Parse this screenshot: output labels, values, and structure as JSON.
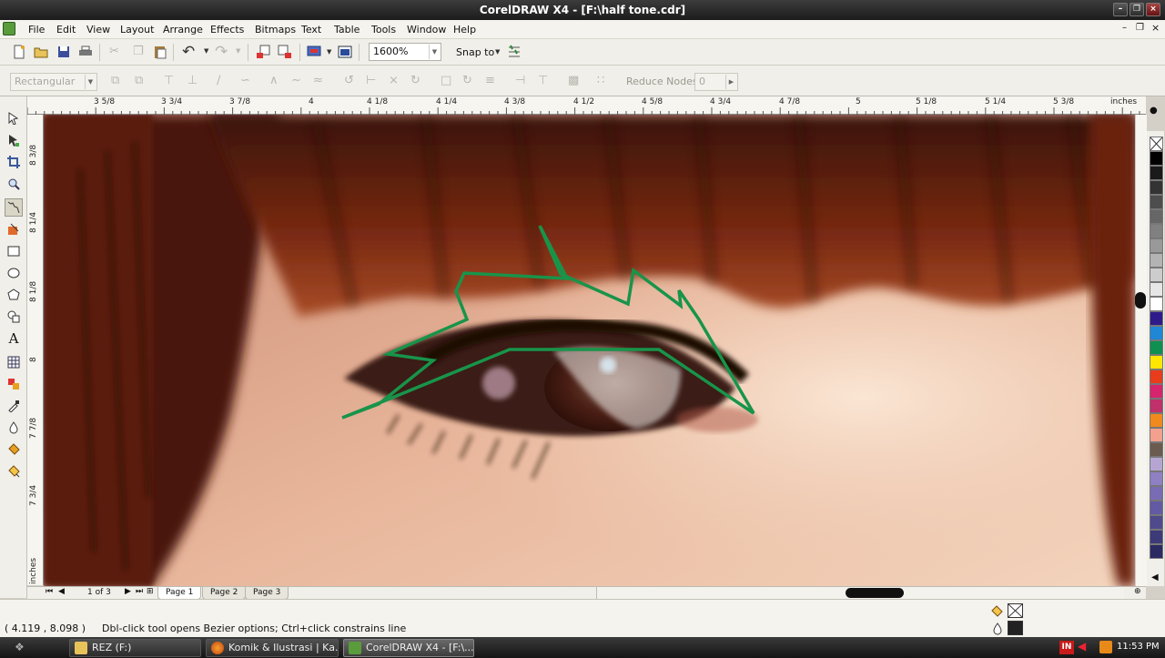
{
  "window": {
    "title": "CorelDRAW X4 - [F:\\half tone.cdr]"
  },
  "menu": [
    "File",
    "Edit",
    "View",
    "Layout",
    "Arrange",
    "Effects",
    "Bitmaps",
    "Text",
    "Table",
    "Tools",
    "Window",
    "Help"
  ],
  "toolbar": {
    "zoom": "1600%",
    "snap_label": "Snap to"
  },
  "property_bar": {
    "mode": "Rectangular",
    "reduce_nodes_label": "Reduce Nodes",
    "reduce_nodes_value": "0"
  },
  "ruler": {
    "unit": "inches",
    "h_labels": [
      "3 5/8",
      "3 3/4",
      "3 7/8",
      "4",
      "4 1/8",
      "4 1/4",
      "4 3/8",
      "4 1/2",
      "4 5/8",
      "4 3/4",
      "4 7/8",
      "5",
      "5 1/8",
      "5 1/4",
      "5 3/8"
    ],
    "v_labels": [
      "8 3/8",
      "8 1/4",
      "8 1/8",
      "8",
      "7 7/8",
      "7 3/4"
    ]
  },
  "pages": {
    "count_label": "1 of 3",
    "tabs": [
      "Page 1",
      "Page 2",
      "Page 3"
    ]
  },
  "status": {
    "coords": "( 4.119 , 8.098 )",
    "hint": "Dbl-click tool opens Bezier options; Ctrl+click constrains line"
  },
  "palette": [
    "#ffffff",
    "#000000",
    "#1a1a1a",
    "#333333",
    "#4d4d4d",
    "#666666",
    "#808080",
    "#999999",
    "#b3b3b3",
    "#cccccc",
    "#e6e6e6",
    "#ffffff",
    "#2e1a8a",
    "#1f87d6",
    "#0f8f50",
    "#ffe600",
    "#e83c1c",
    "#d6246e",
    "#c0306a",
    "#f08a1c",
    "#f3a08f",
    "#6b5b4f",
    "#b6a5d3",
    "#8f80c4",
    "#7a6cb4",
    "#625aa3",
    "#4f4a8c",
    "#3c3a78",
    "#2c2a62"
  ],
  "taskbar": {
    "items": [
      "REZ (F:)",
      "Komik & Ilustrasi | Ka...",
      "CorelDRAW X4 - [F:\\..."
    ],
    "lang": "IN",
    "clock": "11:53 PM"
  }
}
